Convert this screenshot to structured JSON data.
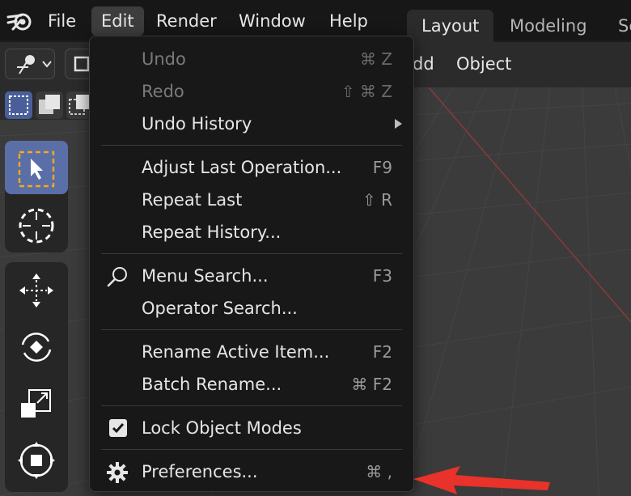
{
  "topbar": {
    "menus": [
      "File",
      "Edit",
      "Render",
      "Window",
      "Help"
    ],
    "workspace_tabs": [
      "Layout",
      "Modeling",
      "Sc"
    ]
  },
  "header": {
    "add_label": "dd",
    "object_label": "Object"
  },
  "edit_menu": {
    "items": [
      {
        "label": "Undo",
        "shortcut": "⌘ Z",
        "disabled": true
      },
      {
        "label": "Redo",
        "shortcut": "⇧ ⌘ Z",
        "disabled": true
      },
      {
        "label": "Undo History",
        "shortcut": "",
        "submenu": true
      },
      {
        "label": "Adjust Last Operation...",
        "shortcut": "F9"
      },
      {
        "label": "Repeat Last",
        "shortcut": "⇧ R"
      },
      {
        "label": "Repeat History...",
        "shortcut": ""
      },
      {
        "label": "Menu Search...",
        "shortcut": "F3",
        "icon": "search-icon"
      },
      {
        "label": "Operator Search...",
        "shortcut": ""
      },
      {
        "label": "Rename Active Item...",
        "shortcut": "F2"
      },
      {
        "label": "Batch Rename...",
        "shortcut": "⌘ F2"
      },
      {
        "label": "Lock Object Modes",
        "shortcut": "",
        "checked": true
      },
      {
        "label": "Preferences...",
        "shortcut": "⌘ ,",
        "icon": "gear-icon"
      }
    ]
  },
  "colors": {
    "accent": "#5a6fa8",
    "annotation_arrow": "#e8322a"
  },
  "icons": {
    "logo": "blender-logo-icon",
    "tools": [
      "select-box-icon",
      "cursor-icon",
      "move-icon",
      "rotate-icon",
      "scale-icon",
      "transform-icon"
    ]
  }
}
